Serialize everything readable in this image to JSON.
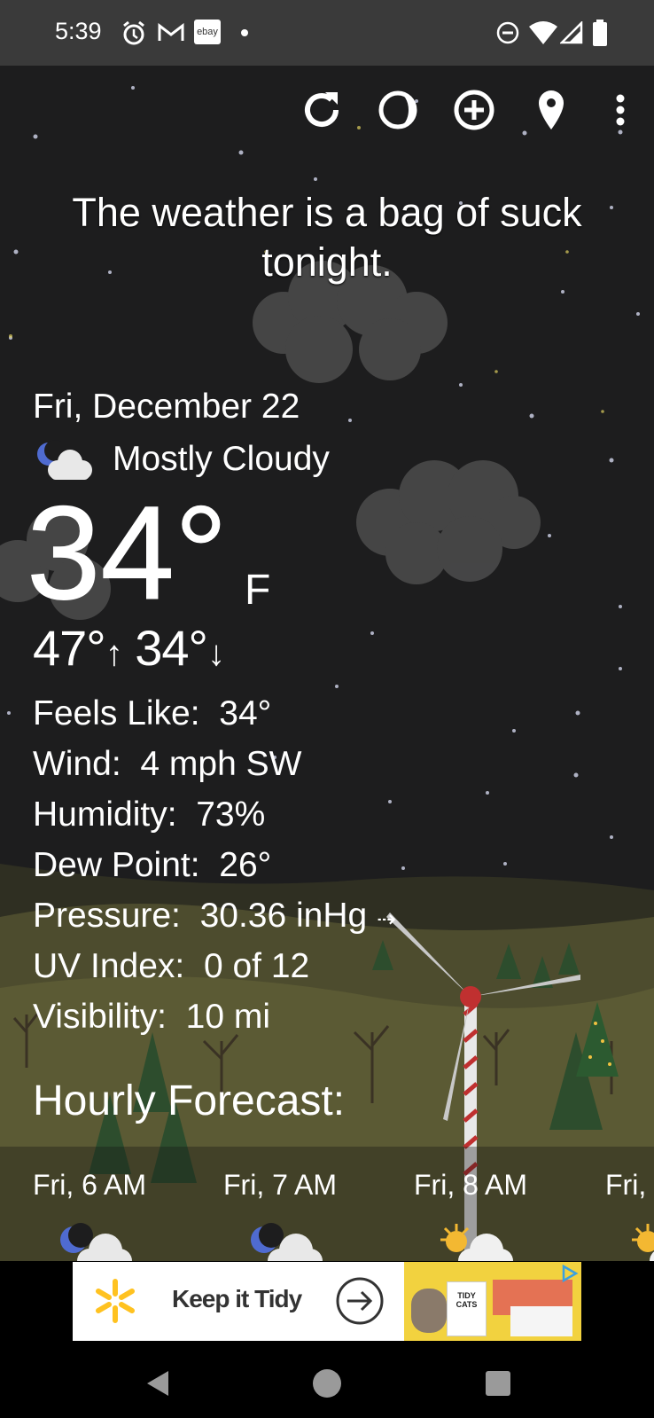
{
  "status_bar": {
    "time": "5:39",
    "notification_icons": [
      "alarm-icon",
      "gmail-icon",
      "ebay-icon",
      "dot-icon"
    ],
    "system_icons": [
      "do-not-disturb-icon",
      "wifi-icon",
      "cell-signal-icon",
      "battery-icon"
    ],
    "ebay_label": "ebay"
  },
  "toolbar": {
    "icons": [
      "refresh-icon",
      "moon-phase-icon",
      "add-location-icon",
      "location-pin-icon",
      "overflow-menu-icon"
    ]
  },
  "tagline": "The weather is a bag of suck tonight.",
  "current": {
    "date": "Fri, December 22",
    "condition_icon": "moon-cloud-icon",
    "condition": "Mostly Cloudy",
    "temperature": "34°",
    "unit": "F",
    "high": "47°",
    "high_arrow": "↑",
    "low": "34°",
    "low_arrow": "↓"
  },
  "details": [
    {
      "label": "Feels Like:",
      "value": "34°"
    },
    {
      "label": "Wind:",
      "value": "4 mph SW"
    },
    {
      "label": "Humidity:",
      "value": "73%"
    },
    {
      "label": "Dew Point:",
      "value": "26°"
    },
    {
      "label": "Pressure:",
      "value": "30.36 inHg",
      "trend": "⇢"
    },
    {
      "label": "UV Index:",
      "value": "0 of 12"
    },
    {
      "label": "Visibility:",
      "value": "10 mi"
    }
  ],
  "hourly": {
    "title": "Hourly Forecast:",
    "items": [
      {
        "time": "Fri, 6 AM",
        "icon": "moon-cloud-icon"
      },
      {
        "time": "Fri, 7 AM",
        "icon": "moon-cloud-icon"
      },
      {
        "time": "Fri, 8 AM",
        "icon": "sun-cloud-icon"
      },
      {
        "time": "Fri,",
        "icon": "sun-cloud-icon"
      }
    ]
  },
  "ad": {
    "text": "Keep it Tidy",
    "brand_icon": "walmart-spark-icon",
    "product_label": "TIDY CATS"
  },
  "nav_bar": {
    "buttons": [
      "back-button",
      "home-button",
      "recents-button"
    ]
  },
  "colors": {
    "status_bar_bg": "#3a3a3a",
    "sky": "#1d1d1e",
    "hill": "#5b5a34",
    "walmart_yellow": "#ffc220",
    "moon_blue": "#4f6bd0"
  }
}
